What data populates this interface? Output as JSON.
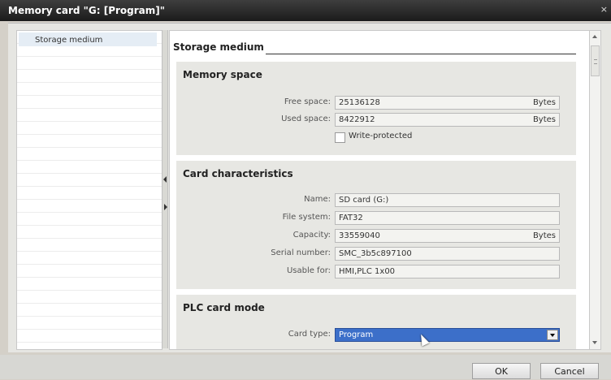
{
  "window": {
    "title": "Memory card \"G: [Program]\"",
    "close_glyph": "×"
  },
  "navigation": {
    "items": [
      {
        "label": "Storage medium",
        "selected": true
      }
    ]
  },
  "main": {
    "section_title": "Storage medium",
    "memory_space": {
      "title": "Memory space",
      "free_space_label": "Free space:",
      "free_space_value": "25136128",
      "free_space_unit": "Bytes",
      "used_space_label": "Used space:",
      "used_space_value": "8422912",
      "used_space_unit": "Bytes",
      "write_protected_label": "Write-protected",
      "write_protected_checked": false
    },
    "card_characteristics": {
      "title": "Card characteristics",
      "name_label": "Name:",
      "name_value": "SD card (G:)",
      "file_system_label": "File system:",
      "file_system_value": "FAT32",
      "capacity_label": "Capacity:",
      "capacity_value": "33559040",
      "capacity_unit": "Bytes",
      "serial_label": "Serial number:",
      "serial_value": "SMC_3b5c897100",
      "usable_label": "Usable for:",
      "usable_value": "HMI,PLC 1x00"
    },
    "plc_card_mode": {
      "title": "PLC card mode",
      "card_type_label": "Card type:",
      "card_type_value": "Program"
    }
  },
  "buttons": {
    "ok": "OK",
    "cancel": "Cancel"
  },
  "colors": {
    "titlebar": "#2a2a2a",
    "selection": "#3c6fc9",
    "group_background": "#e7e7e3"
  }
}
